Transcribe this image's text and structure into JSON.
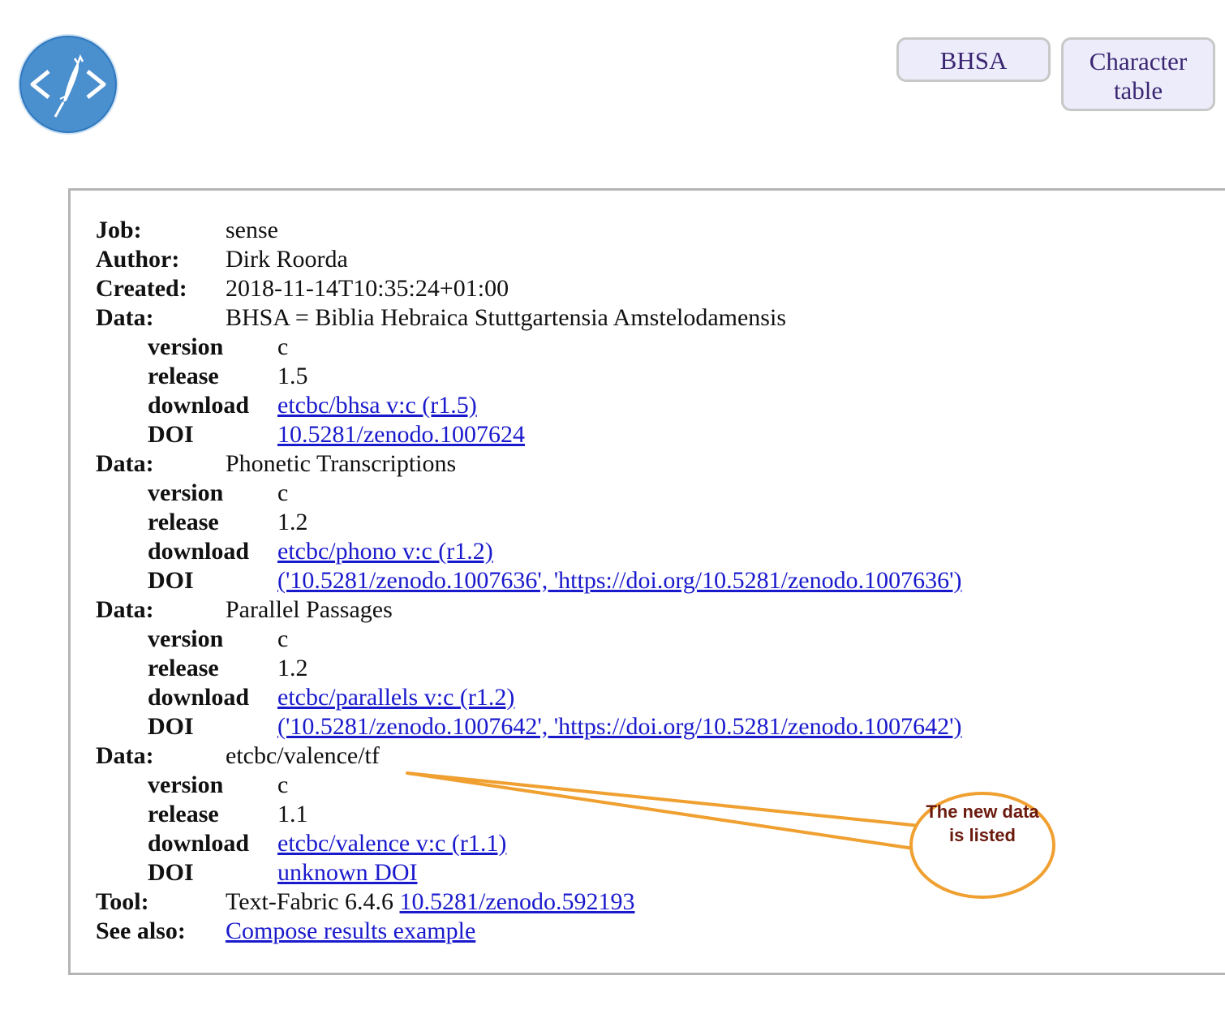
{
  "header": {
    "logo_icon": "code-quill-icon",
    "buttons": {
      "bhsa": "BHSA",
      "character_table": "Character table"
    }
  },
  "info": {
    "job_label": "Job:",
    "job_value": "sense",
    "author_label": "Author:",
    "author_value": "Dirk Roorda",
    "created_label": "Created:",
    "created_value": "2018-11-14T10:35:24+01:00",
    "data_label": "Data:",
    "sub_labels": {
      "version": "version",
      "release": "release",
      "download": "download",
      "doi": "DOI"
    },
    "datasets": [
      {
        "name": "BHSA = Biblia Hebraica Stuttgartensia Amstelodamensis",
        "version": "c",
        "release": "1.5",
        "download": "etcbc/bhsa v:c (r1.5)",
        "doi": "10.5281/zenodo.1007624"
      },
      {
        "name": "Phonetic Transcriptions",
        "version": "c",
        "release": "1.2",
        "download": "etcbc/phono v:c (r1.2)",
        "doi": "('10.5281/zenodo.1007636', 'https://doi.org/10.5281/zenodo.1007636')"
      },
      {
        "name": "Parallel Passages",
        "version": "c",
        "release": "1.2",
        "download": "etcbc/parallels v:c (r1.2)",
        "doi": "('10.5281/zenodo.1007642', 'https://doi.org/10.5281/zenodo.1007642')"
      },
      {
        "name": "etcbc/valence/tf",
        "version": "c",
        "release": "1.1",
        "download": "etcbc/valence v:c (r1.1)",
        "doi": "unknown DOI"
      }
    ],
    "tool_label": "Tool:",
    "tool_value": "Text-Fabric 6.4.6",
    "tool_link": "10.5281/zenodo.592193",
    "see_also_label": "See also:",
    "see_also_link": "Compose results example"
  },
  "annotation": {
    "text": "The new data is listed",
    "color": "#f0a030"
  }
}
